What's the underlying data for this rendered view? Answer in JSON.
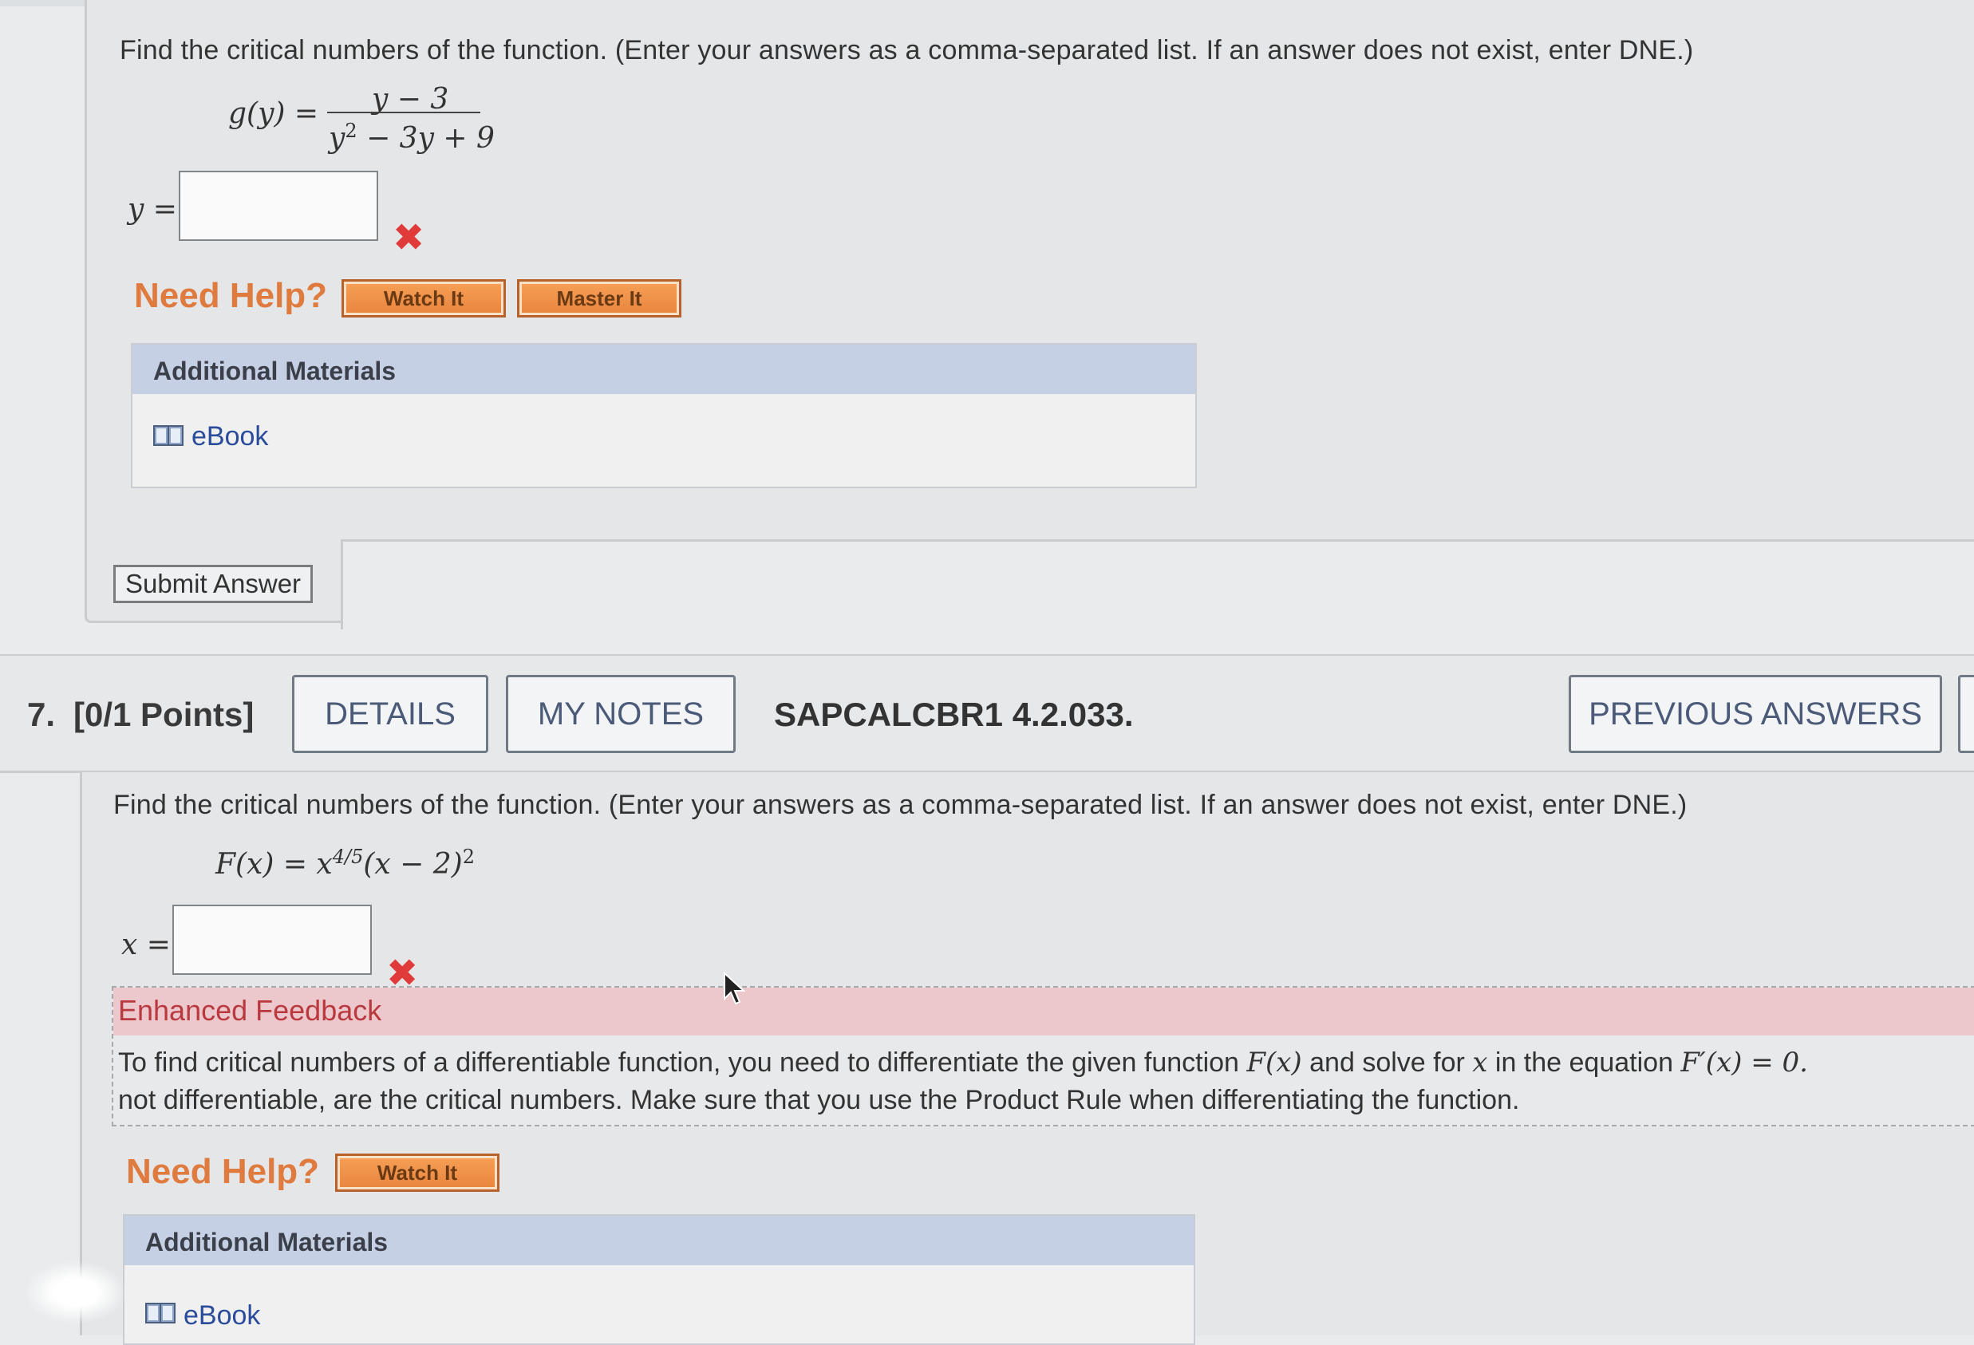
{
  "q6": {
    "prompt": "Find the critical numbers of the function. (Enter your answers as a comma-separated list. If an answer does not exist, enter DNE.)",
    "function_lhs": "g(y) =",
    "numerator": "y − 3",
    "denominator_a": "y",
    "denominator_exp": "2",
    "denominator_b": " − 3y + 9",
    "answer_label": "y =",
    "answer_value": "",
    "need_help": "Need Help?",
    "watch_it": "Watch It",
    "master_it": "Master It",
    "additional_materials": "Additional Materials",
    "ebook": "eBook",
    "submit": "Submit Answer"
  },
  "q7": {
    "number": "7.",
    "points": "[0/1 Points]",
    "details": "DETAILS",
    "my_notes": "MY NOTES",
    "problem_id": "SAPCALCBR1 4.2.033.",
    "previous_answers": "PREVIOUS ANSWERS",
    "prompt": "Find the critical numbers of the function. (Enter your answers as a comma-separated list. If an answer does not exist, enter DNE.)",
    "function_lhs": "F(x) = x",
    "function_exp": "4/5",
    "function_rest": "(x − 2)",
    "function_rest_exp": "2",
    "answer_label": "x =",
    "answer_value": "",
    "feedback_title": "Enhanced Feedback",
    "feedback_line1_a": "To find critical numbers of a differentiable function, you need to differentiate the given function ",
    "feedback_line1_fx": "F(x)",
    "feedback_line1_b": " and solve for ",
    "feedback_line1_x": "x",
    "feedback_line1_c": " in the equation ",
    "feedback_line1_eq": "F′(x) = 0.",
    "feedback_line2": "not differentiable, are the critical numbers. Make sure that you use the Product Rule when differentiating the function.",
    "need_help": "Need Help?",
    "watch_it": "Watch It",
    "additional_materials": "Additional Materials",
    "ebook": "eBook"
  },
  "colors": {
    "need_help": "#e07b3f",
    "error_x": "#e03a3a",
    "feedback_header": "#ecc8cc",
    "feedback_title": "#b9393f",
    "materials_header": "#c6d0e4",
    "link": "#2a4c9a"
  },
  "icons": [
    "incorrect-x-icon",
    "book-icon",
    "mouse-cursor-icon"
  ]
}
